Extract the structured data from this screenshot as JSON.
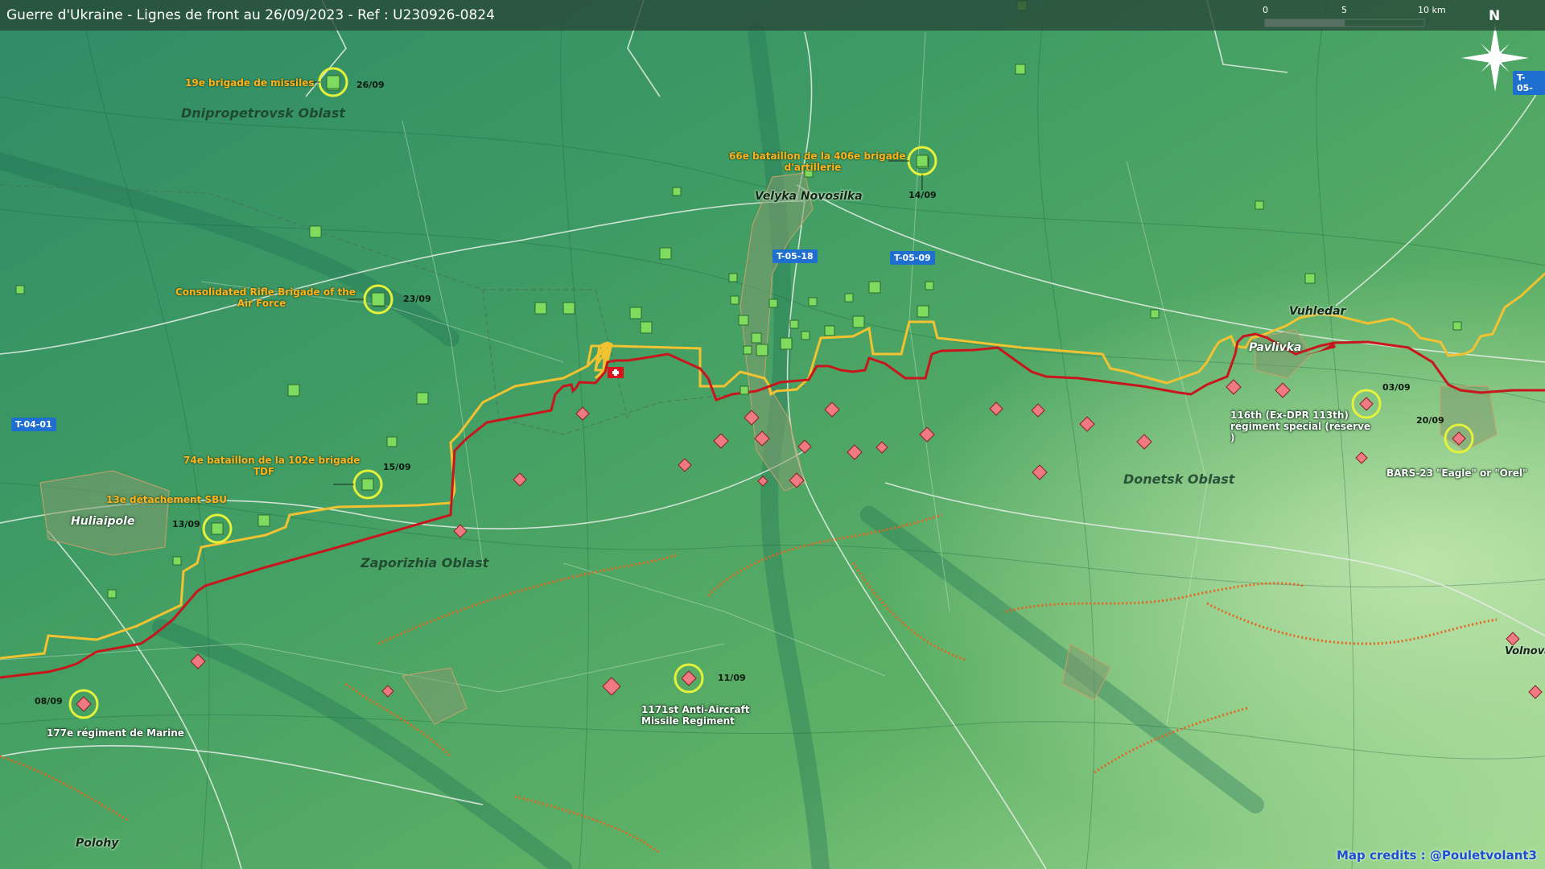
{
  "title": "Guerre d'Ukraine - Lignes de front au 26/09/2023 - Ref : U230926-0824",
  "scale": {
    "tick0": "0",
    "tick1": "5",
    "tick2": "10 km"
  },
  "north_label": "N",
  "credits": "Map credits : @Pouletvolant3",
  "roads": {
    "r1": "T-05-18",
    "r2": "T-05-09",
    "r3": "T-04-01",
    "r4": "T-05-"
  },
  "places": {
    "velyka": "Velyka Novosilka",
    "vuhledar": "Vuhledar",
    "pavlivka": "Pavlivka",
    "huliaipole": "Huliaipole",
    "polohy": "Polohy",
    "volnova": "Volnova"
  },
  "oblasts": {
    "dnipro": "Dnipropetrovsk Oblast",
    "zapo": "Zaporizhia Oblast",
    "donetsk": "Donetsk Oblast"
  },
  "units": {
    "u1": "19e brigade de missiles",
    "u2a": "66e bataillon de la 406e brigade",
    "u2b": "d'artillerie",
    "u3a": "Consolidated Rifle Brigade of the",
    "u3b": "Air Force",
    "u4a": "74e bataillon de la 102e brigade",
    "u4b": "TDF",
    "u5": "13e détachement SBU",
    "u6": "177e régiment de Marine",
    "u7a": "1171st Anti-Aircraft",
    "u7b": "Missile Regiment",
    "u8a": "116th (Ex-DPR 113th)",
    "u8b": "régiment spécial (réserve",
    "u8c": ")",
    "u9": "BARS-23 \"Eagle\" or \"Orel\""
  },
  "dates": {
    "d1": "26/09",
    "d2": "14/09",
    "d3": "23/09",
    "d4": "15/09",
    "d5": "13/09",
    "d6": "08/09",
    "d7": "11/09",
    "d8": "03/09",
    "d9": "20/09"
  },
  "colors": {
    "ukrainian_line": "#f2c230",
    "russian_line": "#c8161d",
    "ukrainian_unit": "#7edb5e",
    "russian_unit": "#f07a84",
    "highlight_ring": "#e6f23a",
    "fortification": "#e8641e",
    "road_badge": "#1f6fd1"
  },
  "icons": {
    "ukr_unit": "green-square-unit-icon",
    "rus_unit": "red-diamond-unit-icon",
    "compass": "compass-rose-icon",
    "flag": "swiss-flag-icon"
  }
}
